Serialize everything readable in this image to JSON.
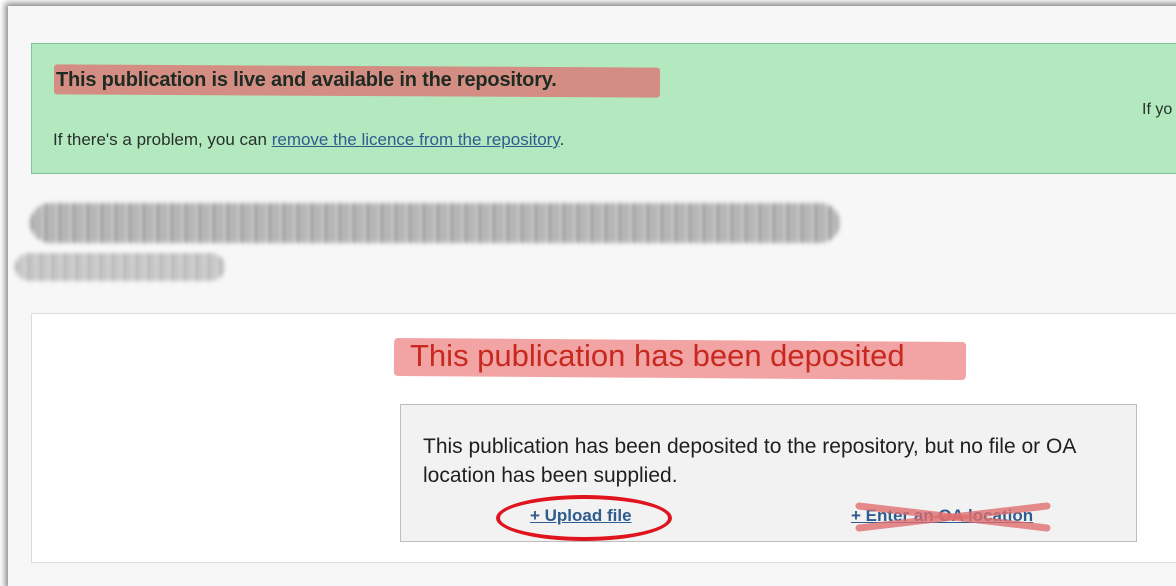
{
  "alert": {
    "title": "This publication is live and available in the repository.",
    "problem_prefix": "If there's a problem, you can ",
    "problem_link": "remove the licence from the repository",
    "problem_suffix": ".",
    "right_text": "If yo"
  },
  "panel": {
    "heading": "This publication has been deposited",
    "info_text": "This publication has been deposited to the repository, but no file or OA location has been supplied.",
    "upload_label": "+ Upload file",
    "oa_label": "+ Enter an OA location"
  },
  "annotations": {
    "strike_color": "#de6e6e",
    "circle_color": "#e0141e"
  }
}
